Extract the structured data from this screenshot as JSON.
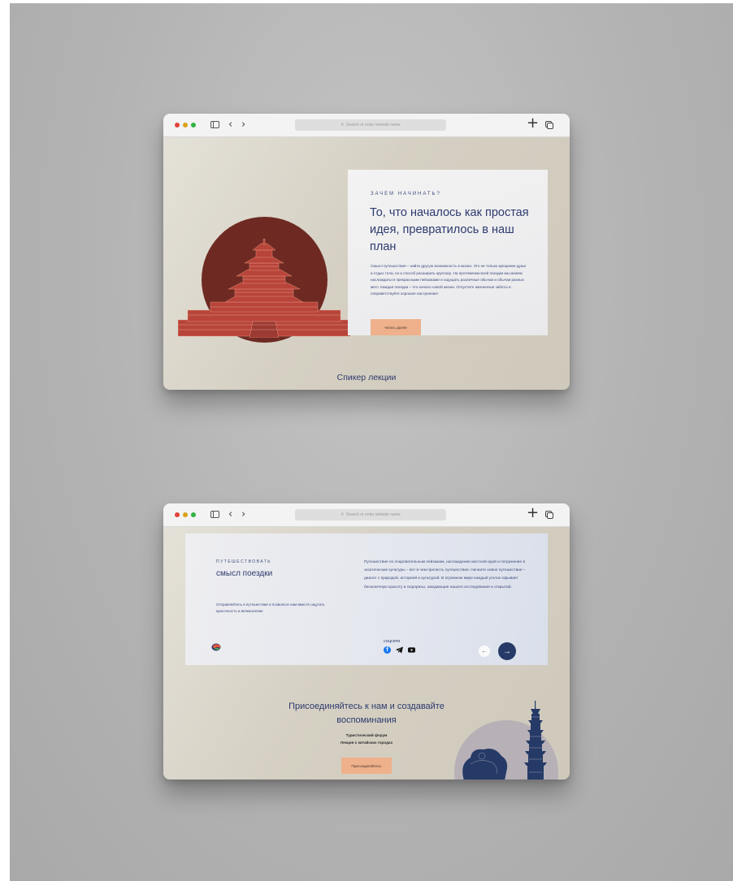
{
  "browser": {
    "address_placeholder": "Search or enter website name",
    "back_icon": "‹",
    "forward_icon": "›",
    "new_tab_icon": "+"
  },
  "screen1": {
    "eyebrow": "ЗАЧЕМ НАЧИНАТЬ?",
    "title": "То, что началось как простая идея, превратилось в наш план",
    "paragraph": "Смысл путешествия – найти другую возможность в жизни. Это не только крещение души и отдых тела, но и способ расширить кругозор. На протяжении всей поездки мы можем наслаждаться прекрасными пейзажами и ощущать различные обычаи и обычаи разных мест. Каждая поездка – это начало новой жизни. Отпустите жизненные заботы и поприветствуйте хорошее настроение!",
    "button": "читать далее",
    "speaker": "Спикер лекции"
  },
  "screen2": {
    "eyebrow": "ПУТЕШЕСТВОВАТЬ",
    "title": "смысл поездки",
    "subtitle": "Отправляйтесь в путешествие и позвольте нам вместе ощутить красочность и великолепие",
    "paragraph": "Путешествие по очаровательным пейзажам, наслаждение местной едой и погружение в экзотические культуры – вот в чем прелесть путешествия. Начните новое путешествие – диалог с природой, историей и культурой. В огромном мире каждый уголок скрывает бесконечную красоту и сюрпризы, ожидающие нашего исследования и открытий.",
    "social_label": "соцсети",
    "prev_icon": "←",
    "next_icon": "→",
    "join_title": "Присоединяйтесь к нам и создавайте воспоминания",
    "join_line1": "Туристический форум",
    "join_line2": "Лекция о китайских городах",
    "join_button": "Присоединяйтесь"
  },
  "colors": {
    "navy": "#2d3a6e",
    "accent": "#efb18c",
    "temple_red": "#b8443a",
    "sun": "#6e2a22"
  }
}
